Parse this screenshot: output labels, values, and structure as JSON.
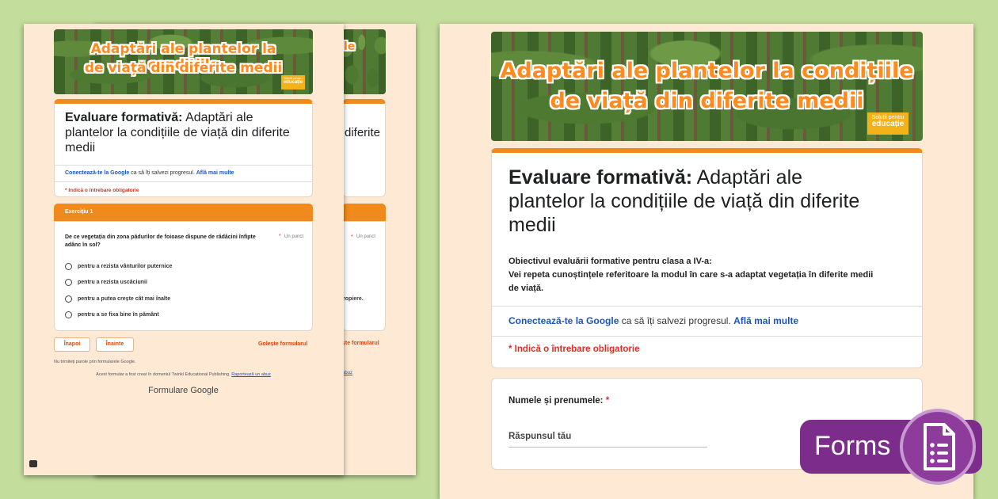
{
  "banner": {
    "title_line1": "Adaptări ale plantelor la condițiile",
    "title_line2": "de viață din diferite medii",
    "brand_top": "Soluții pentru",
    "brand_bottom": "educație"
  },
  "form": {
    "title_bold": "Evaluare formativă:",
    "title_rest_line1": " Adaptări ale",
    "title_line2": "plantelor la condițiile de viață din diferite",
    "title_line3": "medii",
    "objective_line1": "Obiectivul evaluării formative pentru clasa a IV-a:",
    "objective_line2": "Vei repeta cunoștințele referitoare la modul în care s-a adaptat vegetația în diferite medii",
    "objective_line3": "de viață.",
    "signin_link": "Conectează-te la Google",
    "signin_text": " ca să îți salvezi progresul. ",
    "learn_more": "Află mai multe",
    "required_note": "* Indică o întrebare obligatorie",
    "name_label": "Numele și prenumele:",
    "required_star": "*",
    "answer_placeholder": "Răspunsul tău"
  },
  "page1": {
    "section_title": "Exercițiu 1",
    "question": "De ce vegetația din zona pădurilor de foioase dispune de rădăcini înfipte",
    "question_line2": "adânc în sol?",
    "points_star": "*",
    "points": "Un punct",
    "options": [
      "pentru a rezista vânturilor puternice",
      "pentru a rezista uscăciunii",
      "pentru a putea crește cât mai înalte",
      "pentru a se fixa bine în pământ"
    ],
    "back_button": "Înapoi",
    "next_button": "Înainte",
    "clear_form": "Golește formularul",
    "never_submit": "Nu trimiteți parole prin formularele Google.",
    "created_by": "Acest formular a fost creat în domeniul Twinkl Educational Publishing. ",
    "report_abuse": "Raportează un abuz",
    "google_forms_logo": "Formulare Google"
  },
  "back_sheet": {
    "title_fragment": "le",
    "title_line2": "diferite",
    "points": "Un punct",
    "text_fragment": "ropiere.",
    "clear_fragment": "ște formularul",
    "abuse_fragment": "abuz"
  },
  "badge": {
    "label": "Forms",
    "icon": "google-forms-icon"
  },
  "colors": {
    "accent": "#f08a1c",
    "background": "#c3dd9c",
    "sheet": "#fde9d4",
    "badge": "#7c2d8c"
  }
}
